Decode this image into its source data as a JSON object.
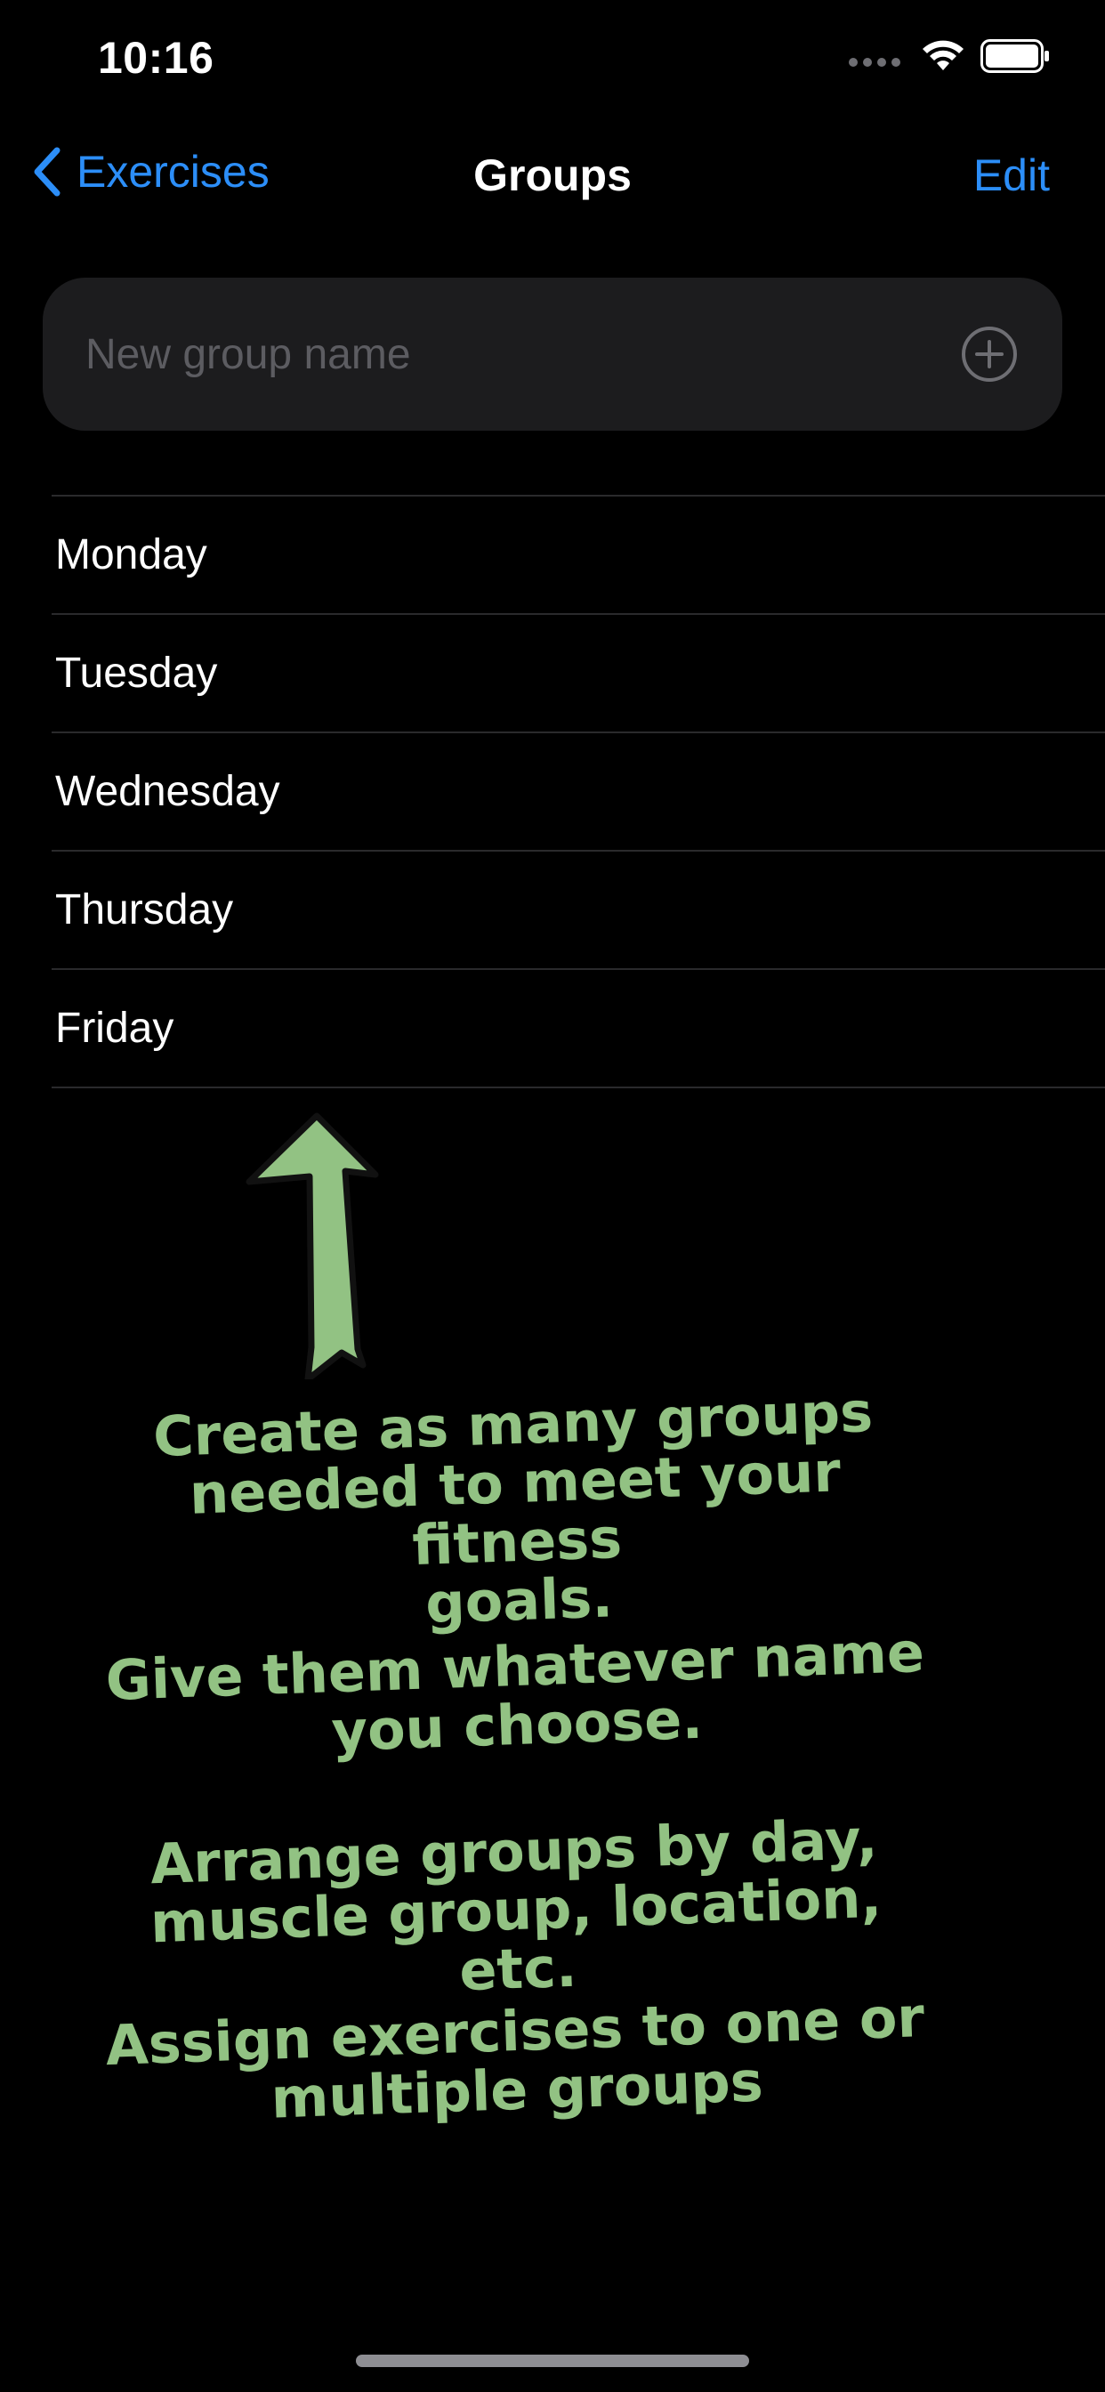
{
  "status_bar": {
    "time": "10:16"
  },
  "nav": {
    "back_label": "Exercises",
    "title": "Groups",
    "edit_label": "Edit"
  },
  "new_group": {
    "placeholder": "New group name",
    "value": ""
  },
  "groups": [
    {
      "label": "Monday"
    },
    {
      "label": "Tuesday"
    },
    {
      "label": "Wednesday"
    },
    {
      "label": "Thursday"
    },
    {
      "label": "Friday"
    }
  ],
  "callouts": [
    "Create as many groups\nneeded to meet your fitness\ngoals.",
    "Give them whatever name\nyou choose.",
    "Arrange groups by day,\nmuscle group, location, etc.",
    "Assign exercises to one or\nmultiple groups"
  ],
  "colors": {
    "accent": "#2c8ef8",
    "callout_text": "#92c283",
    "arrow_fill": "#92c283",
    "field_background": "#1c1c1e",
    "separator": "#2a2a2c"
  },
  "icons": {
    "back": "chevron-left-icon",
    "add": "plus-circle-icon",
    "wifi": "wifi-icon",
    "battery": "battery-icon",
    "signal": "signal-icon",
    "arrow": "up-arrow-icon"
  }
}
